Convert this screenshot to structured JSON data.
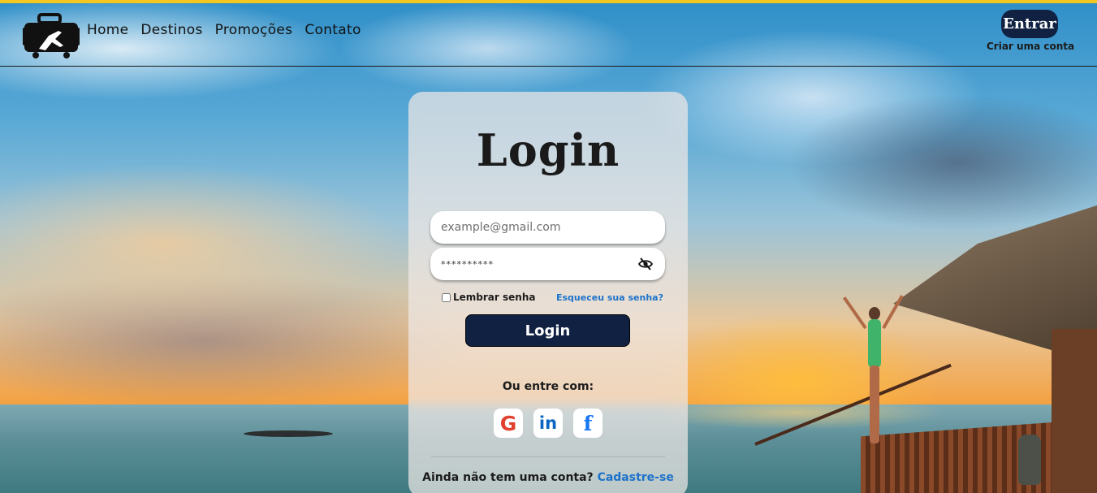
{
  "colors": {
    "accent_bar": "#f3c620",
    "primary_button": "#102142",
    "link": "#1d73c9"
  },
  "header": {
    "logo_icon": "suitcase-plane-icon",
    "nav": [
      {
        "label": "Home"
      },
      {
        "label": "Destinos"
      },
      {
        "label": "Promoções"
      },
      {
        "label": "Contato"
      }
    ],
    "entrar_label": "Entrar",
    "criar_conta_label": "Criar uma conta"
  },
  "login": {
    "title": "Login",
    "email_placeholder": "example@gmail.com",
    "password_value": "**********",
    "password_toggle_icon": "eye-slash-icon",
    "remember_label": "Lembrar senha",
    "remember_checked": false,
    "forgot_label": "Esqueceu sua senha?",
    "submit_label": "Login",
    "or_label": "Ou entre com:",
    "social": [
      {
        "name": "google-icon",
        "glyph": "G"
      },
      {
        "name": "linkedin-icon",
        "glyph": "in"
      },
      {
        "name": "facebook-icon",
        "glyph": "f"
      }
    ],
    "signup_prompt": "Ainda não tem uma conta?",
    "signup_link": "Cadastre-se"
  }
}
